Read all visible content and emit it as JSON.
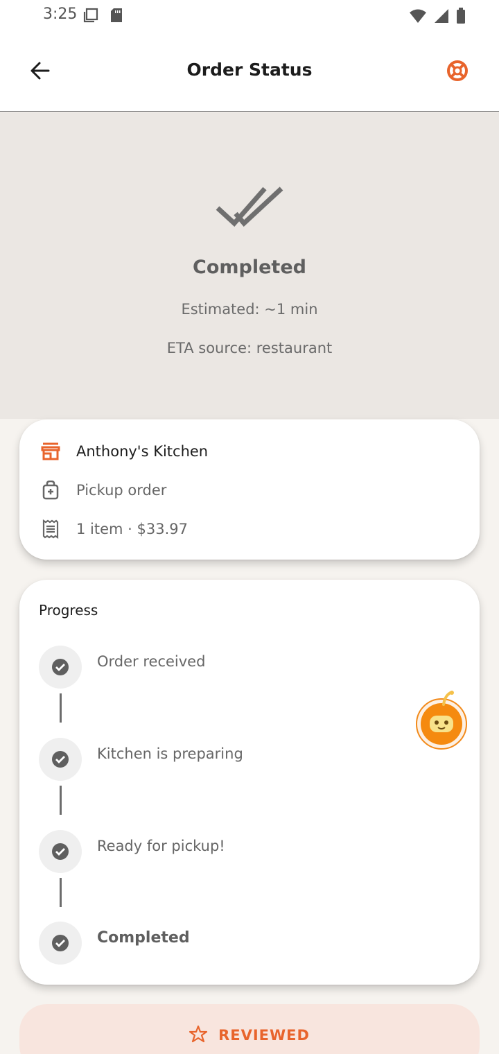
{
  "status_bar": {
    "time": "3:25"
  },
  "header": {
    "title": "Order Status",
    "back_icon": "arrow-left-icon",
    "help_icon": "lifebuoy-icon"
  },
  "hero": {
    "status": "Completed",
    "estimated": "Estimated: ~1 min",
    "eta_source": "ETA source: restaurant",
    "icon": "double-check-icon"
  },
  "order_info": {
    "restaurant": "Anthony's Kitchen",
    "order_type": "Pickup order",
    "summary": "1 item · $33.97"
  },
  "progress": {
    "title": "Progress",
    "steps": [
      {
        "label": "Order received"
      },
      {
        "label": "Kitchen is preparing"
      },
      {
        "label": "Ready for pickup!"
      },
      {
        "label": "Completed"
      }
    ]
  },
  "review_button": {
    "label": "REVIEWED",
    "icon": "star-sparkle-icon"
  },
  "colors": {
    "accent": "#e8642c",
    "hero_bg": "#ebe7e3",
    "page_bg": "#f6f3ef",
    "review_bg": "#f8e5de"
  }
}
